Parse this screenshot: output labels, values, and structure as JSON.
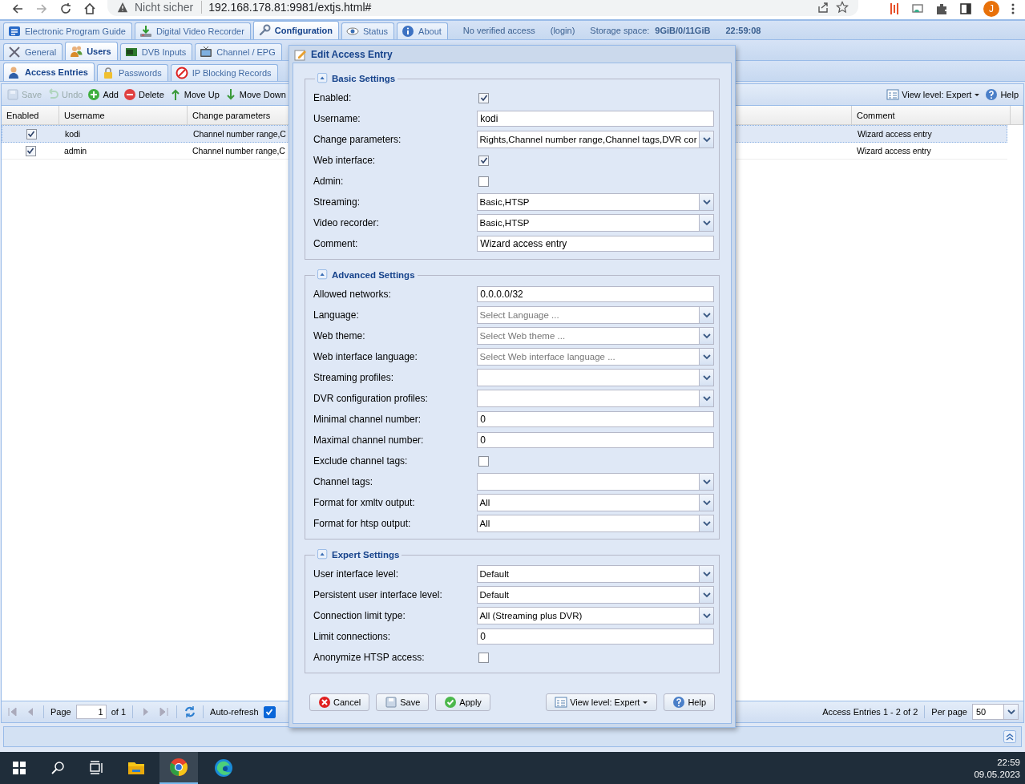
{
  "browser": {
    "security": "Nicht sicher",
    "url": "192.168.178.81:9981/extjs.html#",
    "profile": "J"
  },
  "main_tabs": [
    {
      "label": "Electronic Program Guide",
      "selected": false
    },
    {
      "label": "Digital Video Recorder",
      "selected": false
    },
    {
      "label": "Configuration",
      "selected": true
    },
    {
      "label": "Status",
      "selected": false
    },
    {
      "label": "About",
      "selected": false
    }
  ],
  "header_info": {
    "access": "No verified access",
    "login": "(login)",
    "storage_label": "Storage space:",
    "storage_value": "9GiB/0/11GiB",
    "time": "22:59:08"
  },
  "sub_tabs": [
    {
      "label": "General",
      "selected": false
    },
    {
      "label": "Users",
      "selected": true
    },
    {
      "label": "DVB Inputs",
      "selected": false
    },
    {
      "label": "Channel / EPG",
      "selected": false
    }
  ],
  "section_tabs": [
    {
      "label": "Access Entries",
      "selected": true
    },
    {
      "label": "Passwords",
      "selected": false
    },
    {
      "label": "IP Blocking Records",
      "selected": false
    }
  ],
  "toolbar": {
    "buttons": [
      {
        "label": "Save",
        "disabled": true
      },
      {
        "label": "Undo",
        "disabled": true
      },
      {
        "label": "Add",
        "disabled": false
      },
      {
        "label": "Delete",
        "disabled": false
      },
      {
        "label": "Move Up",
        "disabled": false
      },
      {
        "label": "Move Down",
        "disabled": false
      }
    ],
    "view_level": "View level: Expert",
    "help": "Help"
  },
  "table": {
    "columns": [
      "Enabled",
      "Username",
      "Change parameters",
      "Comment"
    ],
    "rows": [
      {
        "enabled": true,
        "username": "kodi",
        "change_parameters": "Channel number range,C",
        "comment": "Wizard access entry",
        "selected": true
      },
      {
        "enabled": true,
        "username": "admin",
        "change_parameters": "Channel number range,C",
        "comment": "Wizard access entry",
        "selected": false
      }
    ]
  },
  "pager": {
    "page_label": "Page",
    "page": "1",
    "of": "of 1",
    "auto_refresh_label": "Auto-refresh",
    "auto_refresh": true,
    "summary": "Access Entries 1 - 2 of 2",
    "per_page_label": "Per page",
    "per_page": "50"
  },
  "dialog": {
    "title": "Edit Access Entry",
    "sections": [
      {
        "title": "Basic Settings",
        "fields": [
          {
            "label": "Enabled:",
            "kind": "checkbox",
            "checked": true
          },
          {
            "label": "Username:",
            "kind": "text",
            "value": "kodi"
          },
          {
            "label": "Change parameters:",
            "kind": "combo",
            "value": "Rights,Channel number range,Channel tags,DVR cor"
          },
          {
            "label": "Web interface:",
            "kind": "checkbox",
            "checked": true
          },
          {
            "label": "Admin:",
            "kind": "checkbox",
            "checked": false
          },
          {
            "label": "Streaming:",
            "kind": "combo",
            "value": "Basic,HTSP"
          },
          {
            "label": "Video recorder:",
            "kind": "combo",
            "value": "Basic,HTSP"
          },
          {
            "label": "Comment:",
            "kind": "text",
            "value": "Wizard access entry"
          }
        ]
      },
      {
        "title": "Advanced Settings",
        "fields": [
          {
            "label": "Allowed networks:",
            "kind": "text",
            "value": "0.0.0.0/32"
          },
          {
            "label": "Language:",
            "kind": "combo",
            "placeholder": "Select Language ..."
          },
          {
            "label": "Web theme:",
            "kind": "combo",
            "placeholder": "Select Web theme ..."
          },
          {
            "label": "Web interface language:",
            "kind": "combo",
            "placeholder": "Select Web interface language ..."
          },
          {
            "label": "Streaming profiles:",
            "kind": "combo"
          },
          {
            "label": "DVR configuration profiles:",
            "kind": "combo"
          },
          {
            "label": "Minimal channel number:",
            "kind": "text",
            "value": "0"
          },
          {
            "label": "Maximal channel number:",
            "kind": "text",
            "value": "0"
          },
          {
            "label": "Exclude channel tags:",
            "kind": "checkbox",
            "checked": false
          },
          {
            "label": "Channel tags:",
            "kind": "combo"
          },
          {
            "label": "Format for xmltv output:",
            "kind": "combo",
            "value": "All"
          },
          {
            "label": "Format for htsp output:",
            "kind": "combo",
            "value": "All"
          }
        ]
      },
      {
        "title": "Expert Settings",
        "fields": [
          {
            "label": "User interface level:",
            "kind": "combo",
            "value": "Default"
          },
          {
            "label": "Persistent user interface level:",
            "kind": "combo",
            "value": "Default"
          },
          {
            "label": "Connection limit type:",
            "kind": "combo",
            "value": "All (Streaming plus DVR)"
          },
          {
            "label": "Limit connections:",
            "kind": "text",
            "value": "0"
          },
          {
            "label": "Anonymize HTSP access:",
            "kind": "checkbox",
            "checked": false
          }
        ]
      }
    ],
    "buttons": [
      "Cancel",
      "Save",
      "Apply"
    ],
    "view_level": "View level: Expert",
    "help": "Help"
  },
  "taskbar": {
    "time": "22:59",
    "date": "09.05.2023"
  }
}
